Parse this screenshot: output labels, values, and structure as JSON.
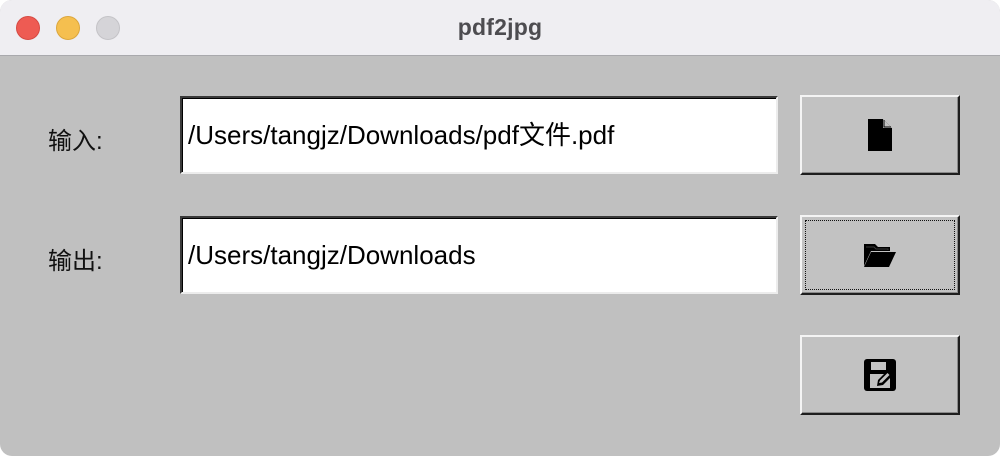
{
  "window": {
    "title": "pdf2jpg"
  },
  "form": {
    "input_label": "输入:",
    "input_value": "/Users/tangjz/Downloads/pdf文件.pdf",
    "output_label": "输出:",
    "output_value": "/Users/tangjz/Downloads"
  },
  "buttons": {
    "open_file_icon": "file-icon",
    "open_folder_icon": "folder-open-icon",
    "convert_icon": "save-edit-icon"
  },
  "colors": {
    "window_bg": "#c0c0c0",
    "titlebar_bg": "#efeef2",
    "close": "#ee5b53",
    "minimize": "#f5bf4f",
    "maximize": "#d5d4d8"
  }
}
